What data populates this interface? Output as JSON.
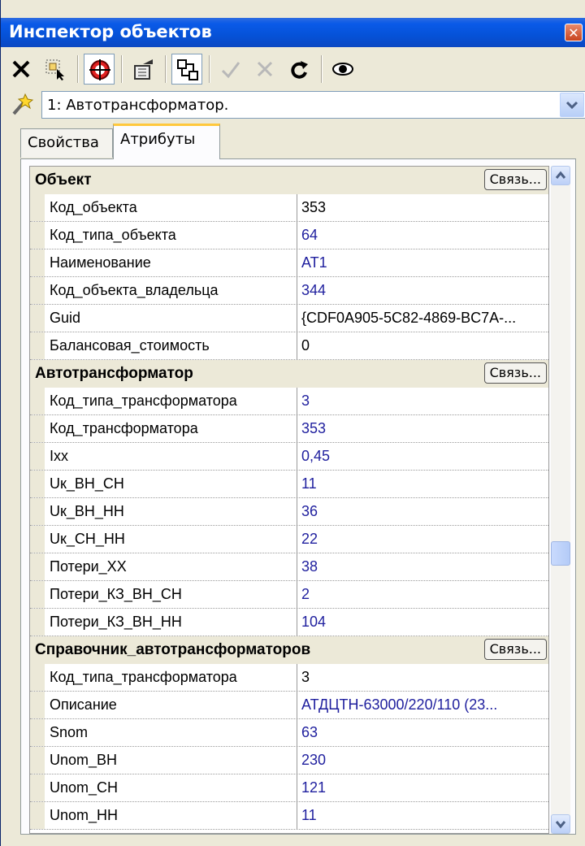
{
  "window": {
    "title": "Инспектор объектов",
    "close_glyph": "✕"
  },
  "toolbar": {
    "icons": [
      "delete-icon",
      "select-objects-icon",
      "target-icon",
      "properties-icon",
      "scheme-icon",
      "apply-icon",
      "cancel-icon",
      "refresh-icon",
      "view-icon"
    ]
  },
  "object_selector": {
    "value": "1: Автотрансформатор."
  },
  "tabs": {
    "properties": "Свойства",
    "attributes": "Атрибуты",
    "active": "attributes"
  },
  "link_label": "Связь...",
  "sections": [
    {
      "title": "Объект",
      "rows": [
        {
          "key": "Код_объекта",
          "value": "353",
          "color": "black"
        },
        {
          "key": "Код_типа_объекта",
          "value": "64",
          "color": "blue"
        },
        {
          "key": "Наименование",
          "value": "АТ1",
          "color": "blue"
        },
        {
          "key": "Код_объекта_владельца",
          "value": "344",
          "color": "blue"
        },
        {
          "key": "Guid",
          "value": "{CDF0A905-5C82-4869-BC7A-...",
          "color": "black"
        },
        {
          "key": "Балансовая_стоимость",
          "value": "0",
          "color": "black"
        }
      ]
    },
    {
      "title": "Автотрансформатор",
      "rows": [
        {
          "key": "Код_типа_трансформатора",
          "value": "3",
          "color": "blue"
        },
        {
          "key": "Код_трансформатора",
          "value": "353",
          "color": "blue"
        },
        {
          "key": "Ixx",
          "value": "0,45",
          "color": "blue"
        },
        {
          "key": "Uк_ВН_СН",
          "value": "11",
          "color": "blue"
        },
        {
          "key": "Uк_ВН_НН",
          "value": "36",
          "color": "blue"
        },
        {
          "key": "Uк_СН_НН",
          "value": "22",
          "color": "blue"
        },
        {
          "key": "Потери_XX",
          "value": "38",
          "color": "blue"
        },
        {
          "key": "Потери_КЗ_ВН_СН",
          "value": "2",
          "color": "blue"
        },
        {
          "key": "Потери_КЗ_ВН_НН",
          "value": "104",
          "color": "blue"
        }
      ]
    },
    {
      "title": "Справочник_автотрансформаторов",
      "rows": [
        {
          "key": "Код_типа_трансформатора",
          "value": "3",
          "color": "black"
        },
        {
          "key": "Описание",
          "value": "АТДЦТН-63000/220/110 (23...",
          "color": "blue"
        },
        {
          "key": "Snom",
          "value": "63",
          "color": "blue"
        },
        {
          "key": "Unom_ВН",
          "value": "230",
          "color": "blue"
        },
        {
          "key": "Unom_СН",
          "value": "121",
          "color": "blue"
        },
        {
          "key": "Unom_НН",
          "value": "11",
          "color": "blue"
        }
      ]
    }
  ]
}
